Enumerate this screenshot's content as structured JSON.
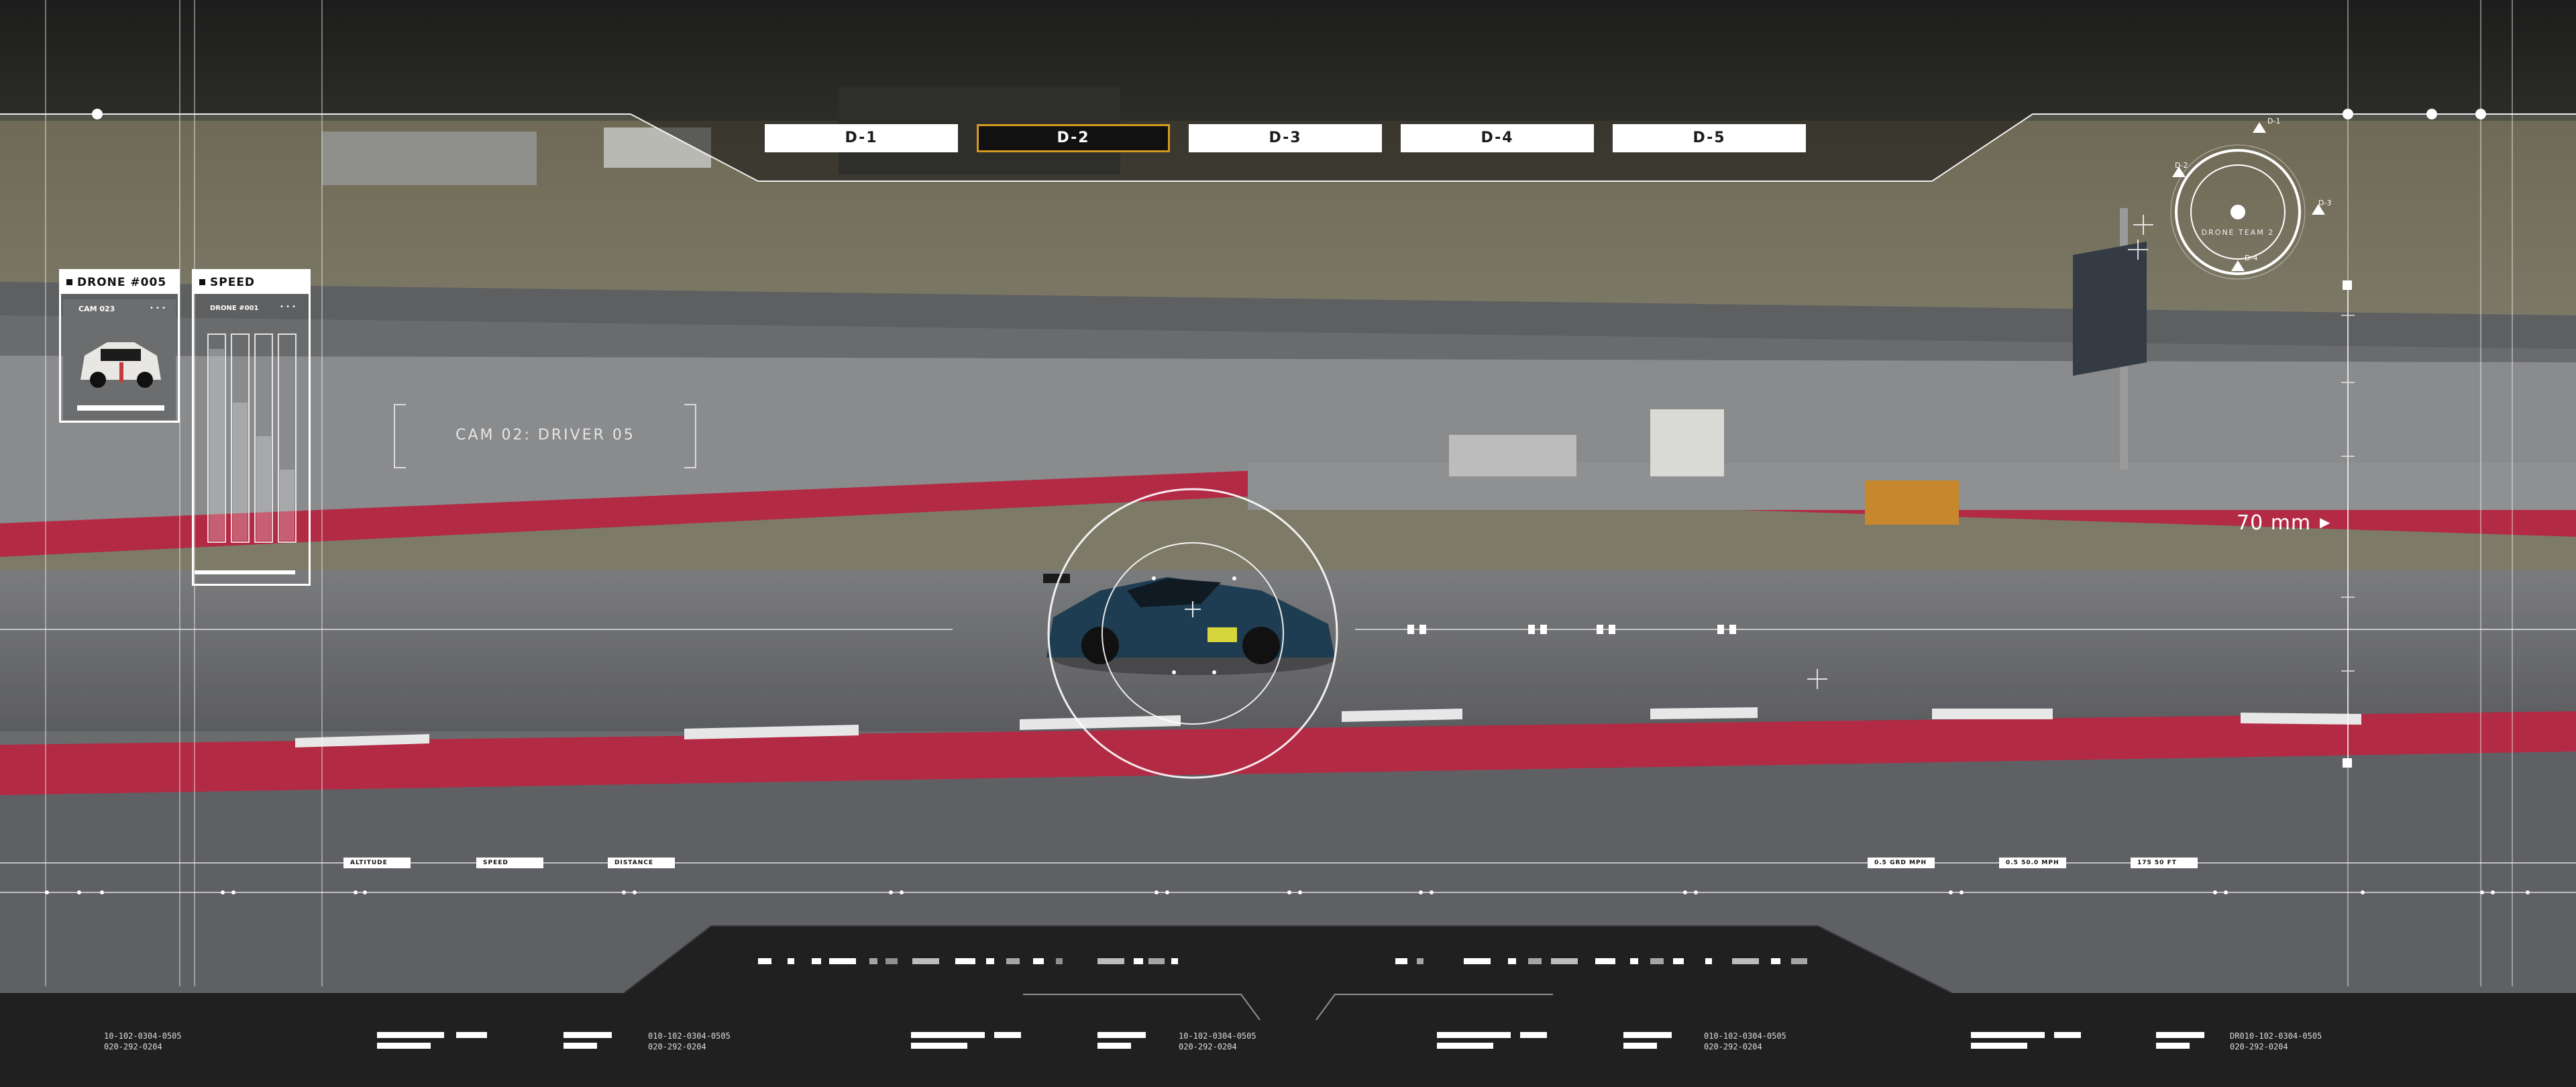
{
  "drone_tabs": [
    {
      "label": "D-1",
      "active": false
    },
    {
      "label": "D-2",
      "active": true
    },
    {
      "label": "D-3",
      "active": false
    },
    {
      "label": "D-4",
      "active": false
    },
    {
      "label": "D-5",
      "active": false
    }
  ],
  "drone_panel": {
    "title": "DRONE #005",
    "cam_label": "CAM 023"
  },
  "speed_panel": {
    "title": "SPEED",
    "sub_label": "DRONE #001"
  },
  "camera_caption": "CAM 02: DRIVER 05",
  "lens": {
    "focal": "70 mm"
  },
  "radar": {
    "label": "DRONE TEAM 2",
    "markers": [
      "D-1",
      "D-2",
      "D-3",
      "D-4"
    ]
  },
  "telemetry_tags_left": [
    "ALTITUDE",
    "SPEED",
    "DISTANCE"
  ],
  "telemetry_tags_right": [
    "0.5 GRD MPH",
    "0.5 50.0 MPH",
    "175 50 FT"
  ],
  "footer_codes": [
    {
      "line1": "10-102-0304-0505",
      "line2": "020-292-0204"
    },
    {
      "line1": "010-102-0304-0505",
      "line2": "020-292-0204"
    },
    {
      "line1": "10-102-0304-0505",
      "line2": "020-292-0204"
    },
    {
      "line1": "010-102-0304-0505",
      "line2": "020-292-0204"
    },
    {
      "line1": "DR010-102-0304-0505",
      "line2": "020-292-0204"
    }
  ],
  "colors": {
    "accent": "#d59a20",
    "hud": "#ffffff",
    "track_red": "#b32a45",
    "asphalt": "#6d6e70"
  }
}
